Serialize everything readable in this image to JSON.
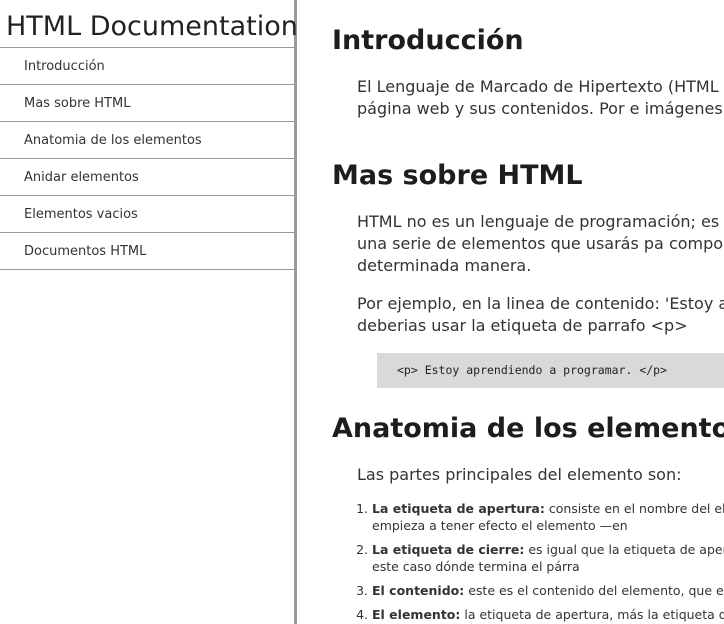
{
  "navbar": {
    "title": "HTML Documentation",
    "items": [
      {
        "label": "Introducción"
      },
      {
        "label": "Mas sobre HTML"
      },
      {
        "label": "Anatomia de los elementos"
      },
      {
        "label": "Anidar elementos"
      },
      {
        "label": "Elementos vacios"
      },
      {
        "label": "Documentos HTML"
      }
    ]
  },
  "sections": {
    "intro": {
      "title": "Introducción",
      "paragraph": "El Lenguaje de Marcado de Hipertexto (HTML - Hy desplegar una página web y sus contenidos. Por e imágenes y tablas de datos."
    },
    "mas": {
      "title": "Mas sobre HTML",
      "paragraph1": "HTML no es un lenguaje de programación; es un l consiste en una serie de elementos que usarás pa comporten de una determinada manera.",
      "paragraph2": "Por ejemplo, en la linea de contenido: 'Estoy apre entonces deberias usar la etiqueta de parrafo <p>",
      "code": "<p> Estoy aprendiendo a programar. </p>"
    },
    "anatomia": {
      "title": "Anatomia de los elementos",
      "intro": "Las partes principales del elemento son:",
      "items": [
        {
          "term": "La etiqueta de apertura:",
          "text": " consiste en el nombre del elemen dónde comienza o empieza a tener efecto el elemento —en"
        },
        {
          "term": "La etiqueta de cierre:",
          "text": " es igual que la etiqueta de apertura, termina el elemento —en este caso dónde termina el párra"
        },
        {
          "term": "El contenido:",
          "text": " este es el contenido del elemento, que en est"
        },
        {
          "term": "El elemento:",
          "text": " la etiqueta de apertura, más la etiqueta de cie"
        }
      ]
    }
  }
}
